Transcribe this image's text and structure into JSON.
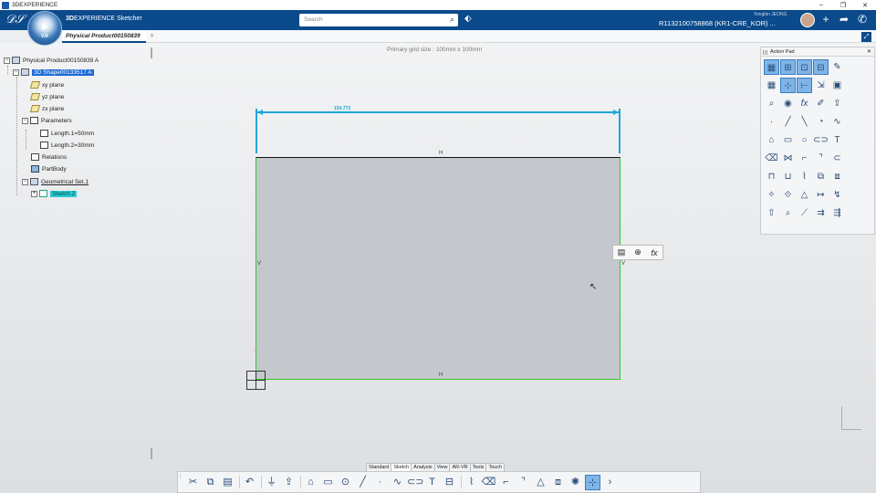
{
  "window": {
    "title": "3DEXPERIENCE",
    "controls": [
      "–",
      "❐",
      "✕"
    ]
  },
  "header": {
    "brand_bold": "3D",
    "brand_rest": "EXPERIENCE Sketcher",
    "search_placeholder": "Search",
    "user_name": "Yongbin JEONG",
    "platform": "R1132100758868 (KR1-CRE_KOR) ...",
    "compass_version": "V.R"
  },
  "tabs": {
    "active": "Physical Product00150839",
    "add": "+"
  },
  "workspace": {
    "grid_caption": "Primary grid size : 100mm x 100mm"
  },
  "tree": {
    "root": "Physical Product00150839 A",
    "shape": "3D Shape00133517 A",
    "xy": "xy plane",
    "yz": "yz plane",
    "zx": "zx plane",
    "parameters": "Parameters",
    "length1": "Length.1=50mm",
    "length2": "Length.2=30mm",
    "relations": "Relations",
    "partbody": "PartBody",
    "geoset": "Geometrical Set.1",
    "sketch": "Sketch.2"
  },
  "sketch": {
    "dimension_label": "154.773",
    "constraint_h": "H",
    "constraint_v": "V"
  },
  "action_pad": {
    "title": "Action Pad",
    "close": "✕"
  },
  "section_tabs": [
    "Standard",
    "Sketch",
    "Analysis",
    "View",
    "AR-VR",
    "Tools",
    "Touch"
  ],
  "colors": {
    "brand_blue": "#0b4a8b",
    "dimension": "#1fa6d8",
    "sketch_green": "#2ec82e",
    "selection": "#1b6ad8"
  }
}
